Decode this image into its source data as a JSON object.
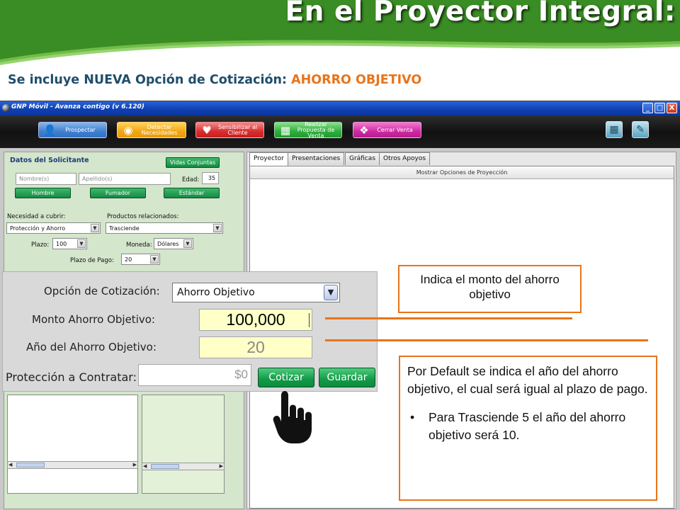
{
  "slide": {
    "title": "En el Proyector Integral:",
    "subtitle_prefix": "Se incluye NUEVA Opción de Cotización: ",
    "subtitle_highlight": "AHORRO OBJETIVO"
  },
  "colors": {
    "banner_green": "#3a8c24",
    "accent_orange": "#e8741a",
    "subtitle_blue": "#1f4e6b",
    "titlebar_blue": "#1346c0"
  },
  "window": {
    "title": "GNP Móvil - Avanza contigo (v 6.120)",
    "controls": {
      "minimize": "_",
      "maximize": "□",
      "close": "X"
    }
  },
  "toolbar": {
    "items": [
      {
        "label": "Prospectar",
        "icon": "person-icon"
      },
      {
        "label": "Detectar Necesidades",
        "icon": "eye-icon"
      },
      {
        "label": "Sensibilizar al Cliente",
        "icon": "heart-icon"
      },
      {
        "label": "Realizar Propuesta de Venta",
        "icon": "document-icon"
      },
      {
        "label": "Cerrar Venta",
        "icon": "handshake-icon"
      }
    ],
    "right_icons": [
      "calculator-icon",
      "pencil-icon"
    ]
  },
  "left_panel": {
    "title": "Datos del Solicitante",
    "vidas_button": "Vidas Conjuntas",
    "nombre_placeholder": "Nombre(s)",
    "apellido_placeholder": "Apellido(s)",
    "edad_label": "Edad:",
    "edad_value": "35",
    "buttons": {
      "hombre": "Hombre",
      "fumador": "Fumador",
      "estandar": "Estándar"
    },
    "necesidad_label": "Necesidad a cubrir:",
    "necesidad_value": "Protección y Ahorro",
    "productos_label": "Productos relacionados:",
    "productos_value": "Trasciende",
    "plazo_label": "Plazo:",
    "plazo_value": "100",
    "moneda_label": "Moneda:",
    "moneda_value": "Dólares",
    "plazo_pago_label": "Plazo de Pago:",
    "plazo_pago_value": "20"
  },
  "right_panel": {
    "tabs": [
      "Proyector",
      "Presentaciones",
      "Gráficas",
      "Otros Apoyos"
    ],
    "active_tab": "Proyector",
    "header": "Mostrar Opciones de Proyección"
  },
  "zoom_panel": {
    "opcion_label": "Opción de Cotización:",
    "opcion_value": "Ahorro Objetivo",
    "monto_label": "Monto Ahorro Objetivo:",
    "monto_value": "100,000",
    "anio_label": "Año del Ahorro Objetivo:",
    "anio_value": "20",
    "proteccion_label": "Protección a Contratar:",
    "proteccion_value": "$0",
    "cotizar_button": "Cotizar",
    "guardar_button": "Guardar"
  },
  "callouts": {
    "monto": "Indica el monto del ahorro objetivo",
    "default_text": "Por Default se indica el año del ahorro objetivo, el cual será igual al plazo de pago.",
    "bullet_mark": "•",
    "bullet": "Para Trasciende 5 el año del ahorro objetivo será 10."
  }
}
